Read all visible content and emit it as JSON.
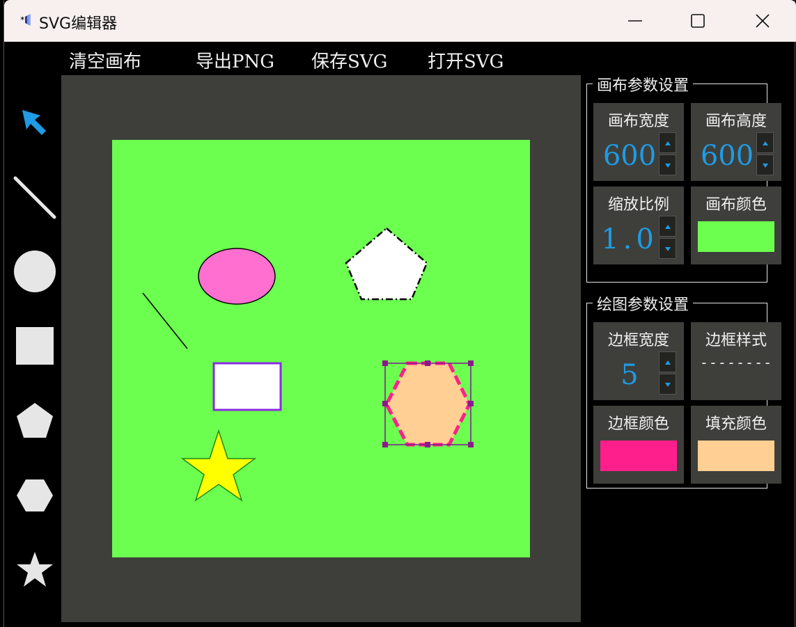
{
  "window": {
    "title": "SVG编辑器"
  },
  "menu": {
    "clear": "清空画布",
    "export_png": "导出PNG",
    "save_svg": "保存SVG",
    "open_svg": "打开SVG"
  },
  "tools": [
    "select-arrow-icon",
    "line-icon",
    "circle-icon",
    "square-icon",
    "pentagon-icon",
    "hexagon-icon",
    "star-icon"
  ],
  "colors": {
    "accent": "#1e9be4",
    "canvas_bg": "#6cff4f",
    "workspace": "#3e3f3b",
    "panel_card": "#3e3f3b",
    "stroke": "#ff1f8c",
    "fill": "#ffcf93"
  },
  "canvas_params": {
    "group_title": "画布参数设置",
    "width_label": "画布宽度",
    "width_value": "600",
    "height_label": "画布高度",
    "height_value": "600",
    "zoom_label": "缩放比例",
    "zoom_value": "1.0",
    "color_label": "画布颜色"
  },
  "draw_params": {
    "group_title": "绘图参数设置",
    "border_width_label": "边框宽度",
    "border_width_value": "5",
    "border_style_label": "边框样式",
    "border_style_value": "--------",
    "border_color_label": "边框颜色",
    "fill_color_label": "填充颜色"
  }
}
